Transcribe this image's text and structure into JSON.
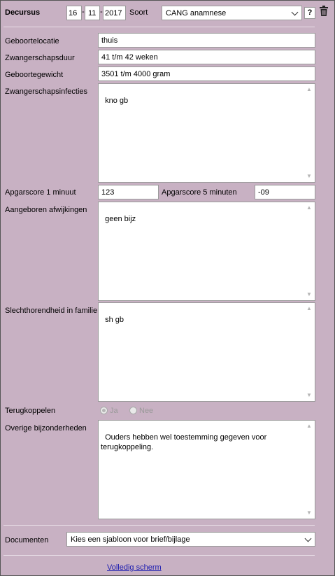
{
  "header": {
    "title": "Decursus",
    "date_day": "16",
    "date_month": "11",
    "date_year": "2017",
    "date_separator": "-",
    "soort_label": "Soort",
    "soort_value": "CANG anamnese",
    "help_label": "?"
  },
  "fields": {
    "geboortelocatie": {
      "label": "Geboortelocatie",
      "value": "thuis"
    },
    "zwangerschapsduur": {
      "label": "Zwangerschapsduur",
      "value": "41 t/m 42 weken"
    },
    "geboortegewicht": {
      "label": "Geboortegewicht",
      "value": "3501 t/m 4000 gram"
    },
    "zwangerschapsinfecties": {
      "label": "Zwangerschapsinfecties",
      "value": "kno gb"
    },
    "apgar1": {
      "label": "Apgarscore 1 minuut",
      "value": "123"
    },
    "apgar5": {
      "label": "Apgarscore 5 minuten",
      "value": "-09"
    },
    "aangeboren": {
      "label": "Aangeboren afwijkingen",
      "value": "geen bijz"
    },
    "slechthorendheid": {
      "label": "Slechthorendheid in familie",
      "value": "sh gb"
    },
    "terugkoppelen": {
      "label": "Terugkoppelen",
      "option_ja": "Ja",
      "option_nee": "Nee",
      "selected": "Ja"
    },
    "overige": {
      "label": "Overige bijzonderheden",
      "value": "Ouders hebben wel toestemming gegeven voor terugkoppeling."
    }
  },
  "documenten": {
    "label": "Documenten",
    "value": "Kies een sjabloon voor brief/bijlage"
  },
  "footer": {
    "link": "Volledig scherm"
  },
  "colors": {
    "background": "#c8b1c3",
    "link": "#1a1ab0"
  }
}
